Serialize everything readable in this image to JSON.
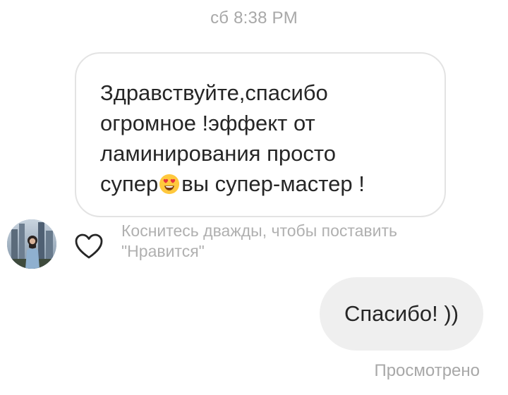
{
  "chat": {
    "timestamp": "сб 8:38 PM",
    "incoming": {
      "lines": [
        "Здравствуйте,спасибо",
        "огромное !эффект от",
        "ламинирования просто"
      ],
      "last_line_before_emoji": "супер",
      "emoji": "smiling-face-with-heart-eyes",
      "last_line_after_emoji": "вы супер-мастер !"
    },
    "like_hint": {
      "line1": "Коснитесь дважды, чтобы поставить",
      "line2": "\"Нравится\""
    },
    "outgoing": {
      "text": "Спасибо! ))"
    },
    "seen_status": "Просмотрено"
  },
  "colors": {
    "bubble_border": "#e3e3e3",
    "outgoing_bubble": "#efefef",
    "meta_text": "#a8a8a8",
    "emoji_face": "#ffc83d",
    "emoji_hearts": "#e8323c"
  }
}
